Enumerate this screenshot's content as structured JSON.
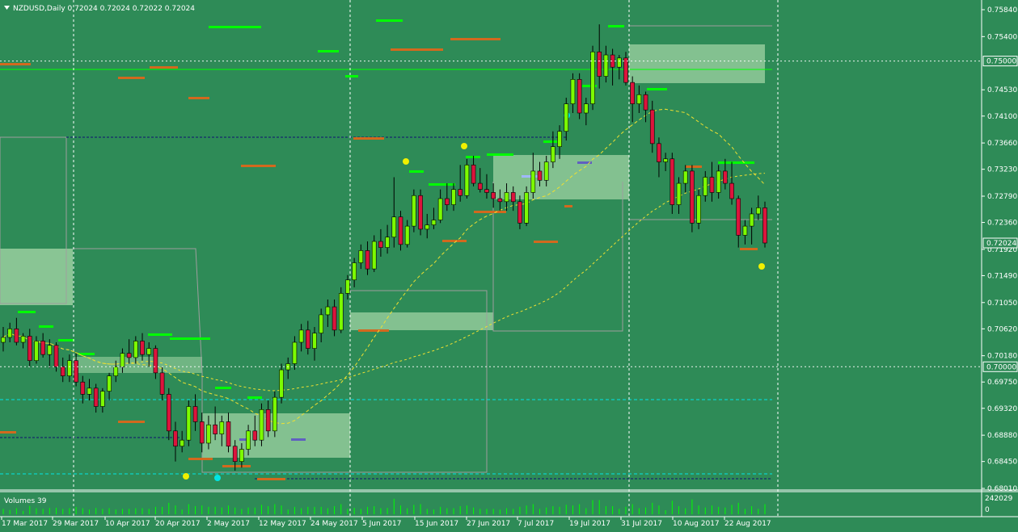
{
  "window": {
    "symbol_header": "NZDUSD,Daily  0.72024 0.72024 0.72022 0.72024",
    "volume_label": "Volumes 39"
  },
  "colors": {
    "background": "#2e8b57",
    "bull_candle": "#7cfc00",
    "bear_candle": "#dc143c",
    "ma_line": "#f0e030",
    "green_level": "#00ff00",
    "orange_level": "#d2691e",
    "zone_fill": "#a8d8a8",
    "cyan_level": "#00e5e5",
    "navy_level": "#101070"
  },
  "chart_data": {
    "type": "candlestick",
    "symbol": "NZDUSD",
    "timeframe": "Daily",
    "last_price": 0.72024,
    "ylim": [
      0.6795,
      0.76
    ],
    "price_axis_ticks": [
      "0.75840",
      "0.75400",
      "0.74530",
      "0.74100",
      "0.73660",
      "0.73230",
      "0.72790",
      "0.72360",
      "0.71920",
      "0.71490",
      "0.71050",
      "0.70620",
      "0.70180",
      "0.69750",
      "0.69320",
      "0.68880",
      "0.68450",
      "0.68010"
    ],
    "price_axis_tick_values": [
      0.7584,
      0.754,
      0.7453,
      0.741,
      0.7366,
      0.7323,
      0.7279,
      0.7236,
      0.7192,
      0.7149,
      0.7105,
      0.7062,
      0.7018,
      0.6975,
      0.6932,
      0.6888,
      0.6845,
      0.6801
    ],
    "highlighted_prices": [
      {
        "label": "0.75000",
        "value": 0.75
      },
      {
        "label": "0.70000",
        "value": 0.7
      },
      {
        "label": "0.72024",
        "value": 0.72024
      }
    ],
    "date_labels": [
      "17 Mar 2017",
      "29 Mar 2017",
      "10 Apr 2017",
      "20 Apr 2017",
      "2 May 2017",
      "12 May 2017",
      "24 May 2017",
      "5 Jun 2017",
      "15 Jun 2017",
      "27 Jun 2017",
      "7 Jul 2017",
      "19 Jul 2017",
      "31 Jul 2017",
      "10 Aug 2017",
      "22 Aug 2017"
    ],
    "volume_axis_ticks": [
      "242029",
      "0"
    ],
    "candles": [
      {
        "o": 0.704,
        "h": 0.7065,
        "l": 0.7025,
        "c": 0.7048
      },
      {
        "o": 0.7048,
        "h": 0.7072,
        "l": 0.704,
        "c": 0.7062
      },
      {
        "o": 0.7062,
        "h": 0.708,
        "l": 0.7035,
        "c": 0.704
      },
      {
        "o": 0.704,
        "h": 0.7055,
        "l": 0.703,
        "c": 0.705
      },
      {
        "o": 0.705,
        "h": 0.7062,
        "l": 0.7,
        "c": 0.701
      },
      {
        "o": 0.701,
        "h": 0.705,
        "l": 0.7005,
        "c": 0.7042
      },
      {
        "o": 0.7042,
        "h": 0.7055,
        "l": 0.7015,
        "c": 0.702
      },
      {
        "o": 0.702,
        "h": 0.7045,
        "l": 0.6998,
        "c": 0.7035
      },
      {
        "o": 0.7035,
        "h": 0.704,
        "l": 0.6992,
        "c": 0.7
      },
      {
        "o": 0.7,
        "h": 0.7015,
        "l": 0.6975,
        "c": 0.6985
      },
      {
        "o": 0.6985,
        "h": 0.702,
        "l": 0.6975,
        "c": 0.701
      },
      {
        "o": 0.701,
        "h": 0.7022,
        "l": 0.6968,
        "c": 0.6975
      },
      {
        "o": 0.6975,
        "h": 0.6985,
        "l": 0.694,
        "c": 0.6955
      },
      {
        "o": 0.6955,
        "h": 0.698,
        "l": 0.6945,
        "c": 0.6965
      },
      {
        "o": 0.6965,
        "h": 0.6972,
        "l": 0.6925,
        "c": 0.6935
      },
      {
        "o": 0.6935,
        "h": 0.6965,
        "l": 0.6925,
        "c": 0.696
      },
      {
        "o": 0.696,
        "h": 0.699,
        "l": 0.6945,
        "c": 0.6985
      },
      {
        "o": 0.6985,
        "h": 0.701,
        "l": 0.6975,
        "c": 0.7
      },
      {
        "o": 0.7,
        "h": 0.703,
        "l": 0.699,
        "c": 0.7022
      },
      {
        "o": 0.7022,
        "h": 0.7045,
        "l": 0.7005,
        "c": 0.7015
      },
      {
        "o": 0.7015,
        "h": 0.705,
        "l": 0.7005,
        "c": 0.7042
      },
      {
        "o": 0.7042,
        "h": 0.7055,
        "l": 0.701,
        "c": 0.702
      },
      {
        "o": 0.702,
        "h": 0.704,
        "l": 0.7,
        "c": 0.703
      },
      {
        "o": 0.703,
        "h": 0.7035,
        "l": 0.698,
        "c": 0.699
      },
      {
        "o": 0.699,
        "h": 0.7,
        "l": 0.6945,
        "c": 0.6955
      },
      {
        "o": 0.6955,
        "h": 0.6965,
        "l": 0.688,
        "c": 0.6895
      },
      {
        "o": 0.6895,
        "h": 0.691,
        "l": 0.6845,
        "c": 0.687
      },
      {
        "o": 0.687,
        "h": 0.6895,
        "l": 0.686,
        "c": 0.688
      },
      {
        "o": 0.688,
        "h": 0.6945,
        "l": 0.687,
        "c": 0.6935
      },
      {
        "o": 0.6935,
        "h": 0.6955,
        "l": 0.6895,
        "c": 0.691
      },
      {
        "o": 0.691,
        "h": 0.6925,
        "l": 0.686,
        "c": 0.6875
      },
      {
        "o": 0.6875,
        "h": 0.692,
        "l": 0.6865,
        "c": 0.6905
      },
      {
        "o": 0.6905,
        "h": 0.6935,
        "l": 0.688,
        "c": 0.689
      },
      {
        "o": 0.689,
        "h": 0.692,
        "l": 0.687,
        "c": 0.691
      },
      {
        "o": 0.691,
        "h": 0.6925,
        "l": 0.686,
        "c": 0.687
      },
      {
        "o": 0.687,
        "h": 0.688,
        "l": 0.683,
        "c": 0.6845
      },
      {
        "o": 0.6845,
        "h": 0.6875,
        "l": 0.6835,
        "c": 0.6865
      },
      {
        "o": 0.6865,
        "h": 0.6905,
        "l": 0.6855,
        "c": 0.6895
      },
      {
        "o": 0.6895,
        "h": 0.692,
        "l": 0.687,
        "c": 0.688
      },
      {
        "o": 0.688,
        "h": 0.694,
        "l": 0.687,
        "c": 0.693
      },
      {
        "o": 0.693,
        "h": 0.6945,
        "l": 0.6885,
        "c": 0.6895
      },
      {
        "o": 0.6895,
        "h": 0.696,
        "l": 0.6885,
        "c": 0.695
      },
      {
        "o": 0.695,
        "h": 0.7005,
        "l": 0.694,
        "c": 0.6995
      },
      {
        "o": 0.6995,
        "h": 0.7015,
        "l": 0.698,
        "c": 0.7005
      },
      {
        "o": 0.7005,
        "h": 0.705,
        "l": 0.6995,
        "c": 0.704
      },
      {
        "o": 0.704,
        "h": 0.707,
        "l": 0.7025,
        "c": 0.706
      },
      {
        "o": 0.706,
        "h": 0.7075,
        "l": 0.702,
        "c": 0.703
      },
      {
        "o": 0.703,
        "h": 0.7065,
        "l": 0.701,
        "c": 0.7055
      },
      {
        "o": 0.7055,
        "h": 0.7095,
        "l": 0.704,
        "c": 0.7085
      },
      {
        "o": 0.7085,
        "h": 0.711,
        "l": 0.7065,
        "c": 0.7098
      },
      {
        "o": 0.7098,
        "h": 0.711,
        "l": 0.705,
        "c": 0.706
      },
      {
        "o": 0.706,
        "h": 0.713,
        "l": 0.7055,
        "c": 0.712
      },
      {
        "o": 0.712,
        "h": 0.715,
        "l": 0.711,
        "c": 0.7142
      },
      {
        "o": 0.7142,
        "h": 0.7178,
        "l": 0.713,
        "c": 0.717
      },
      {
        "o": 0.717,
        "h": 0.72,
        "l": 0.716,
        "c": 0.719
      },
      {
        "o": 0.719,
        "h": 0.7205,
        "l": 0.715,
        "c": 0.716
      },
      {
        "o": 0.716,
        "h": 0.7215,
        "l": 0.7155,
        "c": 0.7205
      },
      {
        "o": 0.7205,
        "h": 0.7225,
        "l": 0.718,
        "c": 0.7195
      },
      {
        "o": 0.7195,
        "h": 0.7232,
        "l": 0.7185,
        "c": 0.7212
      },
      {
        "o": 0.7212,
        "h": 0.731,
        "l": 0.7195,
        "c": 0.7245
      },
      {
        "o": 0.7245,
        "h": 0.7255,
        "l": 0.719,
        "c": 0.72
      },
      {
        "o": 0.72,
        "h": 0.724,
        "l": 0.7195,
        "c": 0.723
      },
      {
        "o": 0.723,
        "h": 0.729,
        "l": 0.722,
        "c": 0.728
      },
      {
        "o": 0.728,
        "h": 0.729,
        "l": 0.7215,
        "c": 0.7225
      },
      {
        "o": 0.7225,
        "h": 0.725,
        "l": 0.721,
        "c": 0.7232
      },
      {
        "o": 0.7232,
        "h": 0.726,
        "l": 0.7225,
        "c": 0.724
      },
      {
        "o": 0.724,
        "h": 0.729,
        "l": 0.7235,
        "c": 0.7275
      },
      {
        "o": 0.7275,
        "h": 0.73,
        "l": 0.7255,
        "c": 0.7265
      },
      {
        "o": 0.7265,
        "h": 0.73,
        "l": 0.7255,
        "c": 0.729
      },
      {
        "o": 0.729,
        "h": 0.733,
        "l": 0.727,
        "c": 0.728
      },
      {
        "o": 0.728,
        "h": 0.734,
        "l": 0.7275,
        "c": 0.733
      },
      {
        "o": 0.733,
        "h": 0.7345,
        "l": 0.7295,
        "c": 0.73
      },
      {
        "o": 0.73,
        "h": 0.7325,
        "l": 0.7285,
        "c": 0.729
      },
      {
        "o": 0.729,
        "h": 0.7315,
        "l": 0.7275,
        "c": 0.7285
      },
      {
        "o": 0.7285,
        "h": 0.73,
        "l": 0.726,
        "c": 0.7275
      },
      {
        "o": 0.7275,
        "h": 0.729,
        "l": 0.7255,
        "c": 0.727
      },
      {
        "o": 0.727,
        "h": 0.73,
        "l": 0.7255,
        "c": 0.7285
      },
      {
        "o": 0.7285,
        "h": 0.7295,
        "l": 0.7255,
        "c": 0.727
      },
      {
        "o": 0.727,
        "h": 0.728,
        "l": 0.7225,
        "c": 0.7235
      },
      {
        "o": 0.7235,
        "h": 0.7295,
        "l": 0.723,
        "c": 0.7285
      },
      {
        "o": 0.7285,
        "h": 0.735,
        "l": 0.7275,
        "c": 0.732
      },
      {
        "o": 0.732,
        "h": 0.7335,
        "l": 0.7295,
        "c": 0.7305
      },
      {
        "o": 0.7305,
        "h": 0.7345,
        "l": 0.7295,
        "c": 0.7335
      },
      {
        "o": 0.7335,
        "h": 0.7385,
        "l": 0.7325,
        "c": 0.736
      },
      {
        "o": 0.736,
        "h": 0.7395,
        "l": 0.734,
        "c": 0.7385
      },
      {
        "o": 0.7385,
        "h": 0.744,
        "l": 0.737,
        "c": 0.743
      },
      {
        "o": 0.743,
        "h": 0.748,
        "l": 0.7415,
        "c": 0.747
      },
      {
        "o": 0.747,
        "h": 0.748,
        "l": 0.7405,
        "c": 0.7415
      },
      {
        "o": 0.7415,
        "h": 0.744,
        "l": 0.7395,
        "c": 0.743
      },
      {
        "o": 0.743,
        "h": 0.7525,
        "l": 0.742,
        "c": 0.7515
      },
      {
        "o": 0.7515,
        "h": 0.756,
        "l": 0.7455,
        "c": 0.7475
      },
      {
        "o": 0.7475,
        "h": 0.7525,
        "l": 0.7465,
        "c": 0.751
      },
      {
        "o": 0.751,
        "h": 0.752,
        "l": 0.746,
        "c": 0.749
      },
      {
        "o": 0.749,
        "h": 0.751,
        "l": 0.747,
        "c": 0.7505
      },
      {
        "o": 0.7505,
        "h": 0.7515,
        "l": 0.746,
        "c": 0.7465
      },
      {
        "o": 0.7465,
        "h": 0.7475,
        "l": 0.74,
        "c": 0.743
      },
      {
        "o": 0.743,
        "h": 0.746,
        "l": 0.7415,
        "c": 0.7445
      },
      {
        "o": 0.7445,
        "h": 0.745,
        "l": 0.74,
        "c": 0.742
      },
      {
        "o": 0.742,
        "h": 0.7435,
        "l": 0.735,
        "c": 0.7365
      },
      {
        "o": 0.7365,
        "h": 0.7375,
        "l": 0.731,
        "c": 0.7335
      },
      {
        "o": 0.7335,
        "h": 0.735,
        "l": 0.732,
        "c": 0.734
      },
      {
        "o": 0.734,
        "h": 0.735,
        "l": 0.725,
        "c": 0.7265
      },
      {
        "o": 0.7265,
        "h": 0.731,
        "l": 0.725,
        "c": 0.73
      },
      {
        "o": 0.73,
        "h": 0.733,
        "l": 0.7285,
        "c": 0.732
      },
      {
        "o": 0.732,
        "h": 0.733,
        "l": 0.722,
        "c": 0.7235
      },
      {
        "o": 0.7235,
        "h": 0.729,
        "l": 0.7225,
        "c": 0.728
      },
      {
        "o": 0.728,
        "h": 0.732,
        "l": 0.727,
        "c": 0.731
      },
      {
        "o": 0.731,
        "h": 0.7335,
        "l": 0.727,
        "c": 0.7285
      },
      {
        "o": 0.7285,
        "h": 0.733,
        "l": 0.7275,
        "c": 0.732
      },
      {
        "o": 0.732,
        "h": 0.734,
        "l": 0.729,
        "c": 0.73
      },
      {
        "o": 0.73,
        "h": 0.7335,
        "l": 0.7265,
        "c": 0.7275
      },
      {
        "o": 0.7275,
        "h": 0.728,
        "l": 0.7195,
        "c": 0.7215
      },
      {
        "o": 0.7215,
        "h": 0.724,
        "l": 0.72,
        "c": 0.723
      },
      {
        "o": 0.723,
        "h": 0.726,
        "l": 0.72,
        "c": 0.725
      },
      {
        "o": 0.725,
        "h": 0.728,
        "l": 0.724,
        "c": 0.726
      },
      {
        "o": 0.726,
        "h": 0.727,
        "l": 0.7195,
        "c": 0.72024
      }
    ]
  }
}
